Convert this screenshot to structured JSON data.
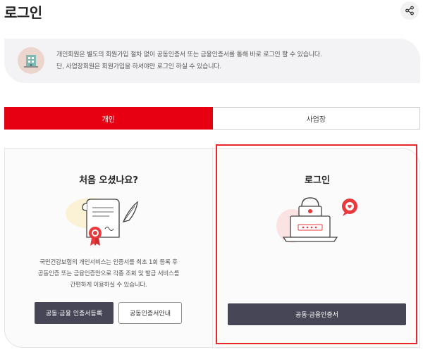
{
  "page": {
    "title": "로그인"
  },
  "icons": {
    "share": "share-icon",
    "notice": "building-icon",
    "certificate": "certificate-icon",
    "laptop": "laptop-lock-icon"
  },
  "notice": {
    "line1": "개인회원은 별도의 회원가입 절차 없이 공동인증서 또는 금융인증서를 통해 바로 로그인 할 수 있습니다.",
    "line2": "단, 사업장회원은 회원가입을 하셔야만 로그인 하실 수 있습니다."
  },
  "tabs": [
    {
      "label": "개인",
      "active": true
    },
    {
      "label": "사업장",
      "active": false
    }
  ],
  "left_card": {
    "title": "처음 오셨나요?",
    "desc_lines": [
      "국민건강보험의 개인서비스는 인증서를 최초 1회 등록 후",
      "공동인증 또는 금융인증만으로 각종 조회 및 발급 서비스를",
      "간편하게 이용하실 수 있습니다."
    ],
    "register_button": "공동·금융 인증서등록",
    "guide_button": "공동인증서안내"
  },
  "right_card": {
    "title": "로그인",
    "login_button": "공동·금융인증서"
  },
  "colors": {
    "accent": "#e60012",
    "dark_button": "#464657",
    "highlight_border": "#e8262c"
  }
}
